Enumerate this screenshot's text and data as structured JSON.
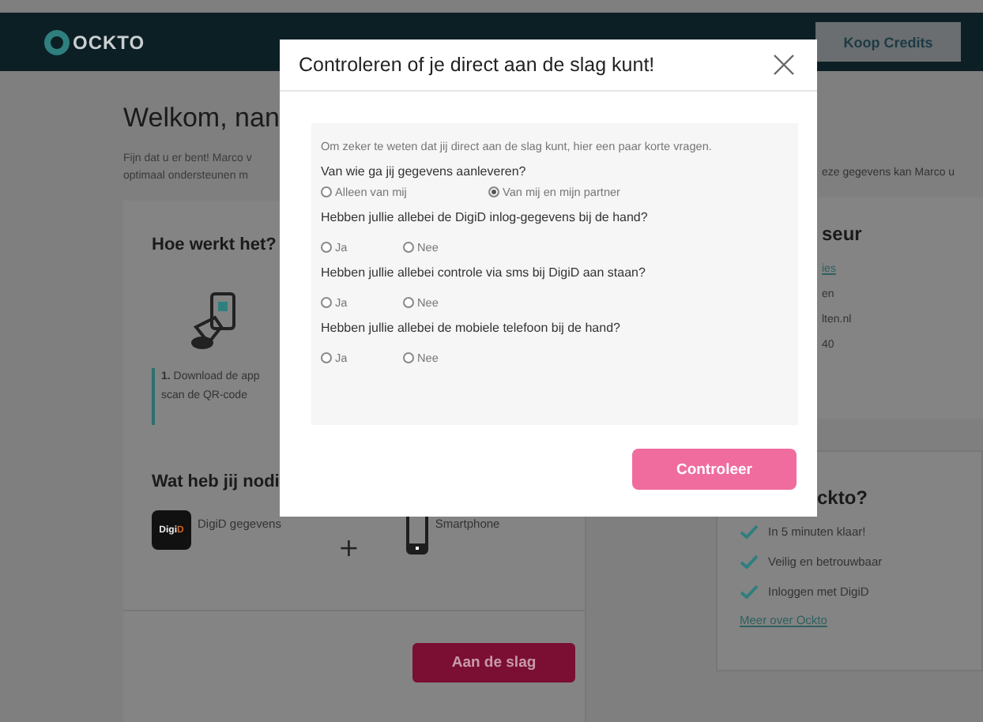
{
  "header": {
    "logo": "OCKTO",
    "button": "Koop Credits"
  },
  "welcome": {
    "title": "Welkom, nan",
    "intro": [
      "Fijn dat u er bent! Marco v",
      "optimaal ondersteunen m"
    ],
    "intro_right": "eze gegevens kan Marco u"
  },
  "how_it_works": {
    "title": "Hoe werkt het?",
    "step": [
      "**1.** Download de app",
      "scan de QR-code"
    ]
  },
  "needs": {
    "title": "Wat heb jij nodi",
    "items": [
      {
        "kind": "digid",
        "logo": "DigiD",
        "label": "DigiD gegevens"
      },
      {
        "kind": "phone",
        "label": "Smartphone"
      }
    ],
    "separator": "+"
  },
  "start_button": "Aan de slag",
  "advisor": {
    "title": "seur",
    "lines": [
      {
        "kind": "link",
        "text": "ies"
      },
      {
        "kind": "text",
        "text": "en"
      },
      {
        "kind": "text",
        "text": "lten.nl"
      },
      {
        "kind": "text",
        "text": "40"
      }
    ]
  },
  "why": {
    "title": "ckto?",
    "points": [
      "In 5 minuten klaar!",
      "Veilig en betrouwbaar",
      "Inloggen met DigiD"
    ],
    "link": "Meer over Ockto"
  },
  "modal": {
    "title": "Controleren of je direct aan de slag kunt!",
    "intro": "Om zeker te weten dat jij direct aan de slag kunt, hier een paar korte vragen.",
    "questions": [
      {
        "text": "Van wie ga jij gegevens aanleveren?",
        "options": [
          {
            "label": "Alleen van mij",
            "selected": false
          },
          {
            "label": "Van mij en mijn partner",
            "selected": true
          }
        ]
      },
      {
        "text": "Hebben jullie allebei de DigiD inlog-gegevens bij de hand?",
        "options": [
          {
            "label": "Ja",
            "selected": false
          },
          {
            "label": "Nee",
            "selected": false
          }
        ]
      },
      {
        "text": "Hebben jullie allebei controle via sms bij DigiD aan staan?",
        "options": [
          {
            "label": "Ja",
            "selected": false
          },
          {
            "label": "Nee",
            "selected": false
          }
        ]
      },
      {
        "text": "Hebben jullie allebei de mobiele telefoon bij de hand?",
        "options": [
          {
            "label": "Ja",
            "selected": false
          },
          {
            "label": "Nee",
            "selected": false
          }
        ]
      }
    ],
    "submit": "Controleer"
  }
}
